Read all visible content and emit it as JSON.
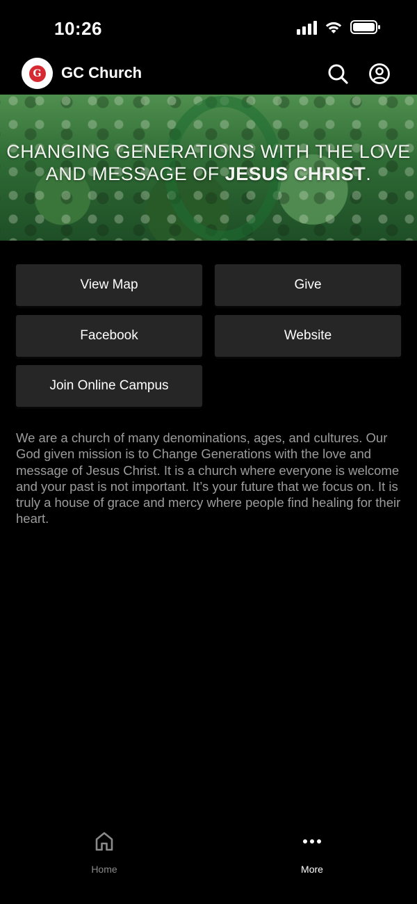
{
  "status_bar": {
    "time": "10:26",
    "icons": [
      "cellular-signal-icon",
      "wifi-icon",
      "battery-icon"
    ]
  },
  "header": {
    "logo_letter": "G",
    "title": "GC Church",
    "icons": [
      "search-icon",
      "account-icon"
    ]
  },
  "banner": {
    "line1": "CHANGING GENERATIONS WITH THE LOVE",
    "line2_prefix": "AND MESSAGE OF ",
    "line2_bold": "JESUS CHRIST",
    "line2_suffix": "."
  },
  "buttons": {
    "view_map": "View Map",
    "give": "Give",
    "facebook": "Facebook",
    "website": "Website",
    "join_online_campus": "Join Online Campus"
  },
  "description": "We are a church of many denominations, ages, and cultures. Our God given mission is to Change Generations with the love and message of Jesus Christ. It is a church where everyone is welcome and your past is not important.  It’s your future that we focus on.  It is truly a house of grace and mercy where people find healing for their heart.",
  "bottom_nav": {
    "items": [
      {
        "label": "Home",
        "icon": "home-icon",
        "active": false
      },
      {
        "label": "More",
        "icon": "more-icon",
        "active": true
      }
    ]
  },
  "colors": {
    "background": "#000000",
    "button_bg": "#262626",
    "description_text": "#9c9c9c",
    "logo_red": "#d62a33"
  }
}
